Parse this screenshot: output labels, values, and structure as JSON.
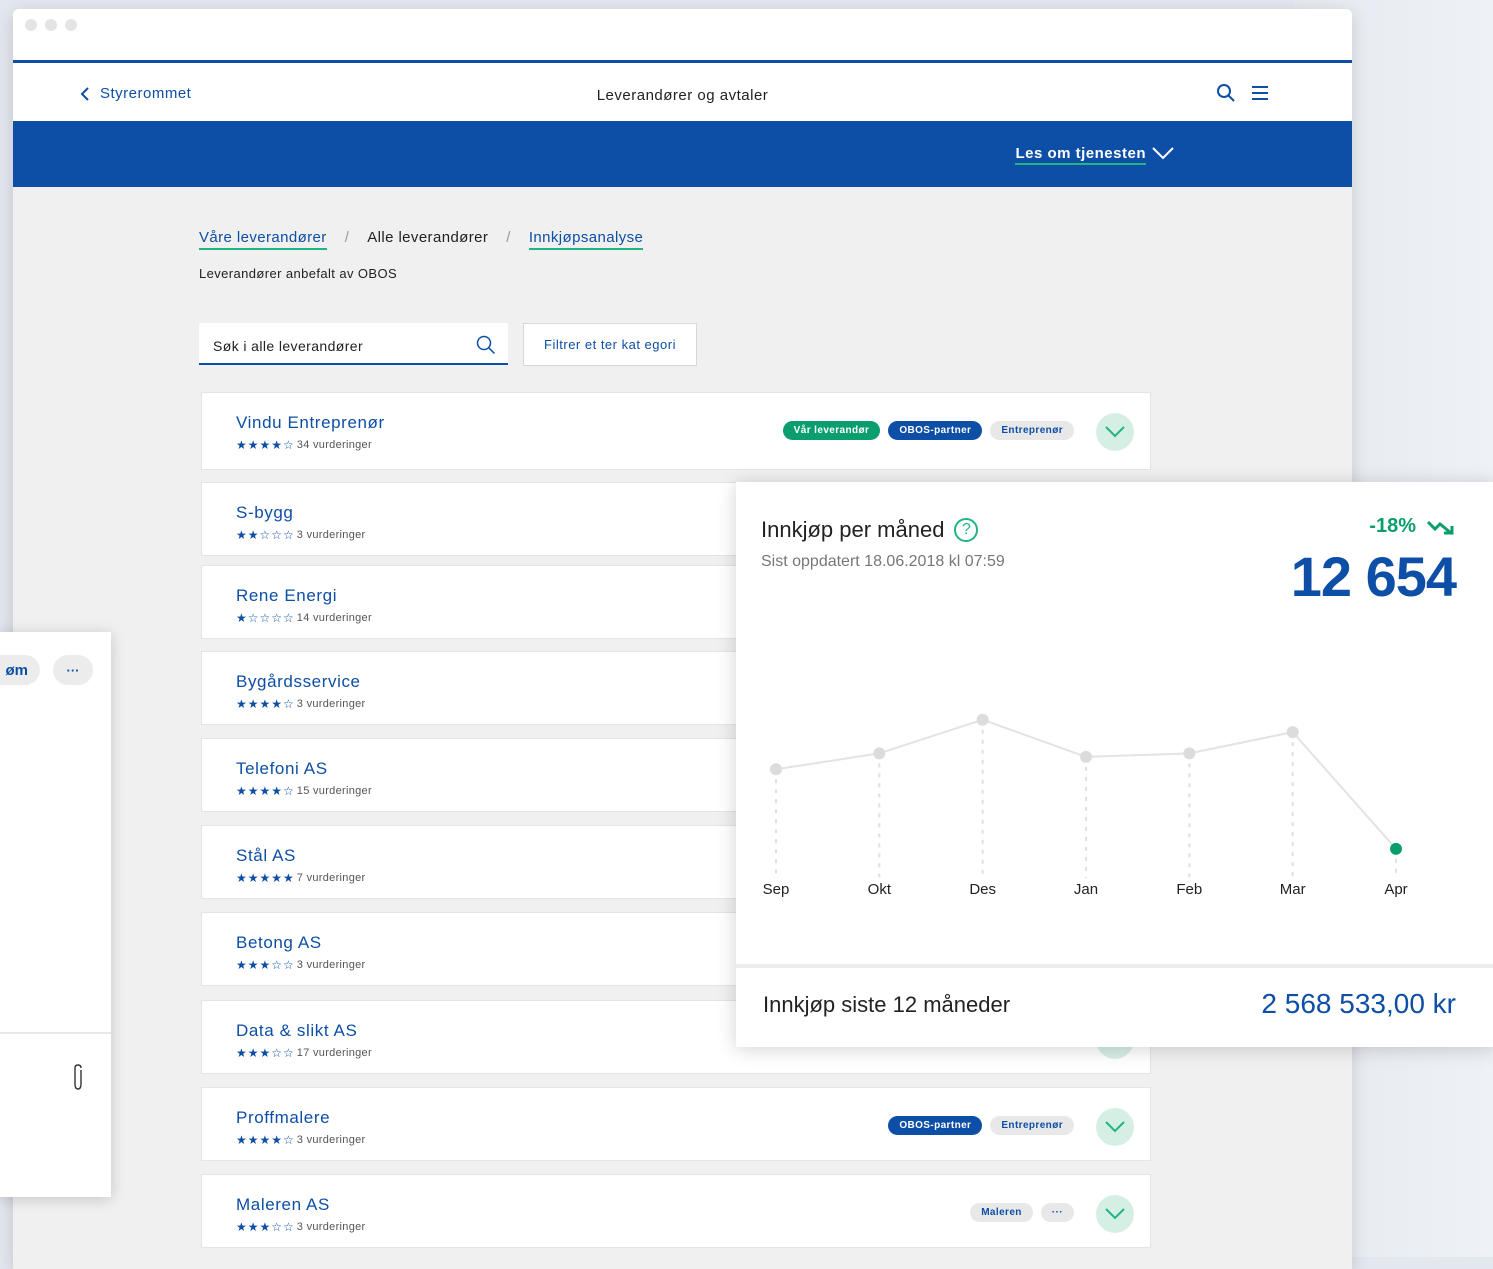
{
  "topnav": {
    "back_label": "Styrerommet",
    "title": "Leverandører og avtaler"
  },
  "banner": {
    "read_more": "Les om tjenesten"
  },
  "breadcrumb": {
    "item1": "Våre leverandører",
    "sep": "/",
    "item2": "Alle leverandører",
    "item3": "Innkjøpsanalyse"
  },
  "subtitle": "Leverandører anbefalt av OBOS",
  "search": {
    "value": "Søk i alle leverandører"
  },
  "filter_label": "Filtrer et ter kat egori",
  "suppliers": [
    {
      "name": "Vindu Entreprenør",
      "stars": "★★★★☆",
      "rating": "34 vurderinger",
      "tags": [
        {
          "t": "Vår leverandør",
          "c": "green"
        },
        {
          "t": "OBOS-partner",
          "c": "blue"
        },
        {
          "t": "Entreprenør",
          "c": "grey"
        }
      ]
    },
    {
      "name": "S-bygg",
      "stars": "★★☆☆☆",
      "rating": "3 vurderinger",
      "tags": []
    },
    {
      "name": "Rene Energi",
      "stars": "★☆☆☆☆",
      "rating": "14 vurderinger",
      "tags": []
    },
    {
      "name": "Bygårdsservice",
      "stars": "★★★★☆",
      "rating": "3 vurderinger",
      "tags": []
    },
    {
      "name": "Telefoni AS",
      "stars": "★★★★☆",
      "rating": "15 vurderinger",
      "tags": []
    },
    {
      "name": "Stål AS",
      "stars": "★★★★★",
      "rating": "7 vurderinger",
      "tags": []
    },
    {
      "name": "Betong AS",
      "stars": "★★★☆☆",
      "rating": "3 vurderinger",
      "tags": []
    },
    {
      "name": "Data & slikt AS",
      "stars": "★★★☆☆",
      "rating": "17 vurderinger",
      "tags": []
    },
    {
      "name": "Proffmalere",
      "stars": "★★★★☆",
      "rating": "3 vurderinger",
      "tags": [
        {
          "t": "OBOS-partner",
          "c": "blue"
        },
        {
          "t": "Entreprenør",
          "c": "grey"
        }
      ]
    },
    {
      "name": "Maleren AS",
      "stars": "★★★☆☆",
      "rating": "3 vurderinger",
      "tags": [
        {
          "t": "Maleren",
          "c": "grey"
        },
        {
          "t": "···",
          "c": "grey"
        }
      ]
    }
  ],
  "left_panel": {
    "pill_label": "øm",
    "more_label": "···"
  },
  "stats": {
    "title": "Innkjøp per måned",
    "help": "?",
    "updated": "Sist oppdatert 18.06.2018 kl 07:59",
    "change": "-18%",
    "value": "12 654",
    "footer_label": "Innkjøp siste 12 måneder",
    "footer_value": "2 568 533,00 kr"
  },
  "chart_data": {
    "type": "line",
    "x": [
      "Sep",
      "Okt",
      "Des",
      "Jan",
      "Feb",
      "Mar",
      "Apr"
    ],
    "values": [
      14900,
      15350,
      16300,
      15250,
      15350,
      15950,
      12654
    ],
    "colors": {
      "line": "#e3e3e3",
      "point": "#dcdcdc",
      "highlight": "#0a9e6e"
    }
  },
  "colors": {
    "brand": "#0d4ea6",
    "accent": "#21b486"
  }
}
